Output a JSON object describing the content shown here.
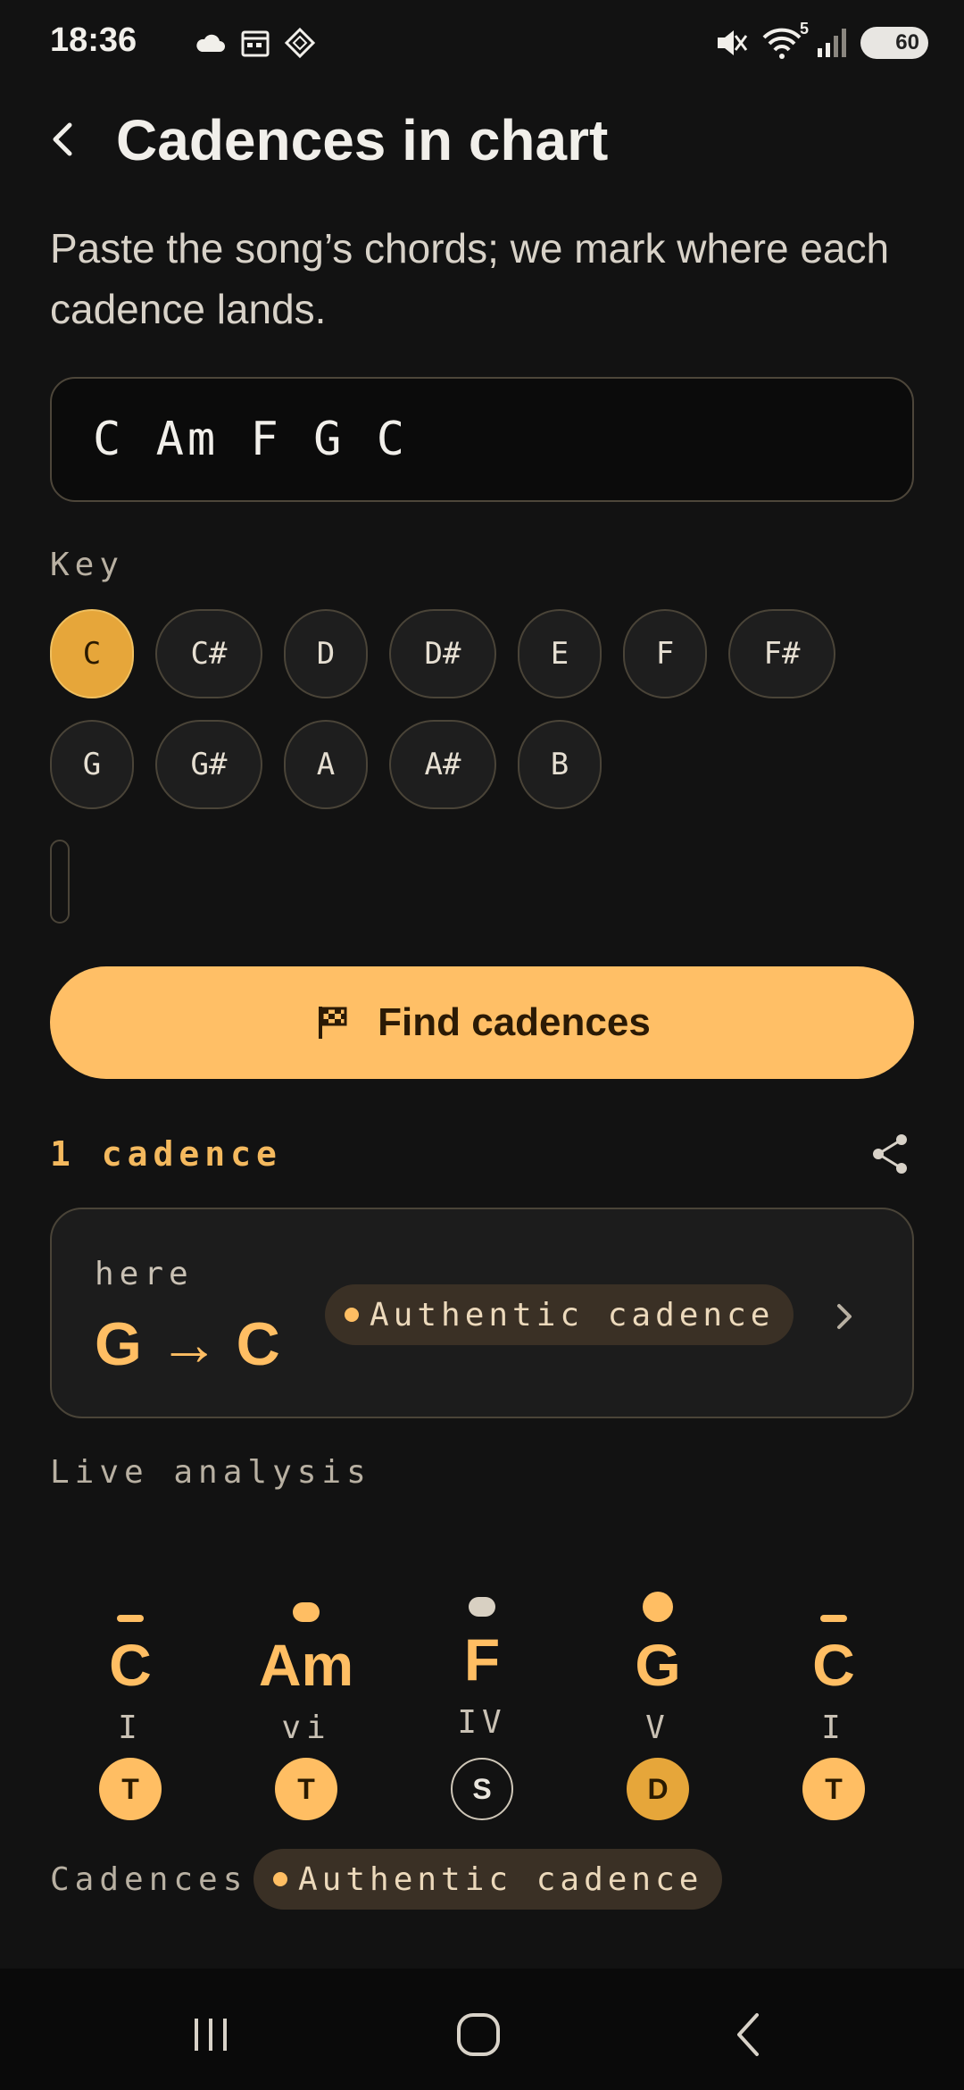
{
  "status_bar": {
    "time": "18:36",
    "left_icons": [
      "cloud-moon-icon",
      "calendar-icon",
      "diamond-app-icon"
    ],
    "right_icons": [
      "mute-icon",
      "wifi-icon",
      "signal-icon"
    ],
    "wifi_badge": "5",
    "battery": "60"
  },
  "header": {
    "title": "Cadences in chart",
    "subtitle": "Paste the song’s chords; we mark where each cadence lands."
  },
  "input": {
    "value": "C Am F G C"
  },
  "key_selector": {
    "label": "Key",
    "selected": "C",
    "row1": [
      "C",
      "C#",
      "D",
      "D#",
      "E",
      "F",
      "F#"
    ],
    "row2": [
      "G",
      "G#",
      "A",
      "A#",
      "B"
    ]
  },
  "find_button": {
    "label": "Find cadences",
    "icon": "flag-icon"
  },
  "results": {
    "count": "1 cadence",
    "card": {
      "position_label": "here",
      "progression": "G → C",
      "badge": "Authentic cadence"
    }
  },
  "live_analysis": {
    "label": "Live analysis",
    "chords": [
      {
        "chord": "C",
        "numeral": "I",
        "function": "T",
        "marker": "bar"
      },
      {
        "chord": "Am",
        "numeral": "vi",
        "function": "T",
        "marker": "pill"
      },
      {
        "chord": "F",
        "numeral": "IV",
        "function": "S",
        "marker": "pill-grey"
      },
      {
        "chord": "G",
        "numeral": "V",
        "function": "D",
        "marker": "dot"
      },
      {
        "chord": "C",
        "numeral": "I",
        "function": "T",
        "marker": "bar"
      }
    ]
  },
  "cadences_footer": {
    "label": "Cadences",
    "badge": "Authentic cadence"
  },
  "colors": {
    "accent": "#ffbf66",
    "selected_key": "#e6a63a",
    "background": "#121212"
  }
}
